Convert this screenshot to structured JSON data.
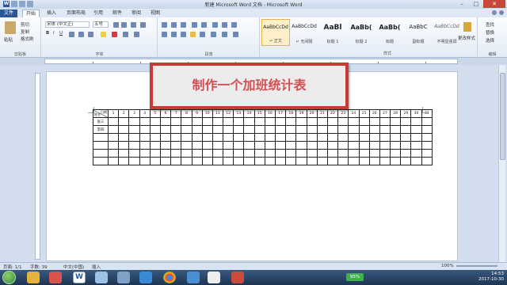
{
  "window": {
    "title": "新建 Microsoft Word 文档 - Microsoft Word"
  },
  "tabs": [
    "文件",
    "开始",
    "插入",
    "页面布局",
    "引用",
    "邮件",
    "审阅",
    "视图"
  ],
  "ribbon": {
    "clipboard": {
      "paste": "粘贴",
      "cut": "剪切",
      "copy": "复制",
      "format_painter": "格式刷",
      "label": "剪贴板"
    },
    "font": {
      "name": "宋体 (中文正)",
      "size": "五号",
      "label": "字体"
    },
    "paragraph": {
      "label": "段落"
    },
    "styles_label": "样式",
    "styles": [
      {
        "sample": "AaBbCcDd",
        "name": "↵ 正文"
      },
      {
        "sample": "AaBbCcDd",
        "name": "↵ 无间隔"
      },
      {
        "sample": "AaBl",
        "name": "标题 1"
      },
      {
        "sample": "AaBb(",
        "name": "标题 2"
      },
      {
        "sample": "AaBb(",
        "name": "标题"
      },
      {
        "sample": "AaBbC",
        "name": "副标题"
      },
      {
        "sample": "AaBbCcDd",
        "name": "不明显强调"
      }
    ],
    "change_styles": "更改样式",
    "editing": {
      "find": "查找",
      "replace": "替换",
      "select": "选择",
      "label": "编辑"
    }
  },
  "banner": {
    "text": "制作一个加班统计表"
  },
  "table": {
    "header_top": "日期",
    "header_bottom": "姓名",
    "days": [
      "1",
      "2",
      "3",
      "4",
      "5",
      "6",
      "7",
      "8",
      "9",
      "10",
      "11",
      "12",
      "13",
      "14",
      "15",
      "16",
      "17",
      "18",
      "19",
      "20",
      "21",
      "22",
      "23",
      "24",
      "25",
      "26",
      "27",
      "28",
      "29",
      "30",
      "31"
    ],
    "rows": [
      "张三",
      "李四",
      "",
      "",
      "",
      ""
    ]
  },
  "statusbar": {
    "page": "页面: 1/1",
    "words": "字数: 39",
    "lang": "中文(中国)",
    "mode": "插入",
    "zoom": "100%"
  },
  "taskbar": {
    "battery": "95%",
    "time": "14:53",
    "date": "2017-10-30"
  },
  "colors": {
    "accent": "#2b579a",
    "banner_border": "#c93a37",
    "banner_text": "#d34f52"
  }
}
